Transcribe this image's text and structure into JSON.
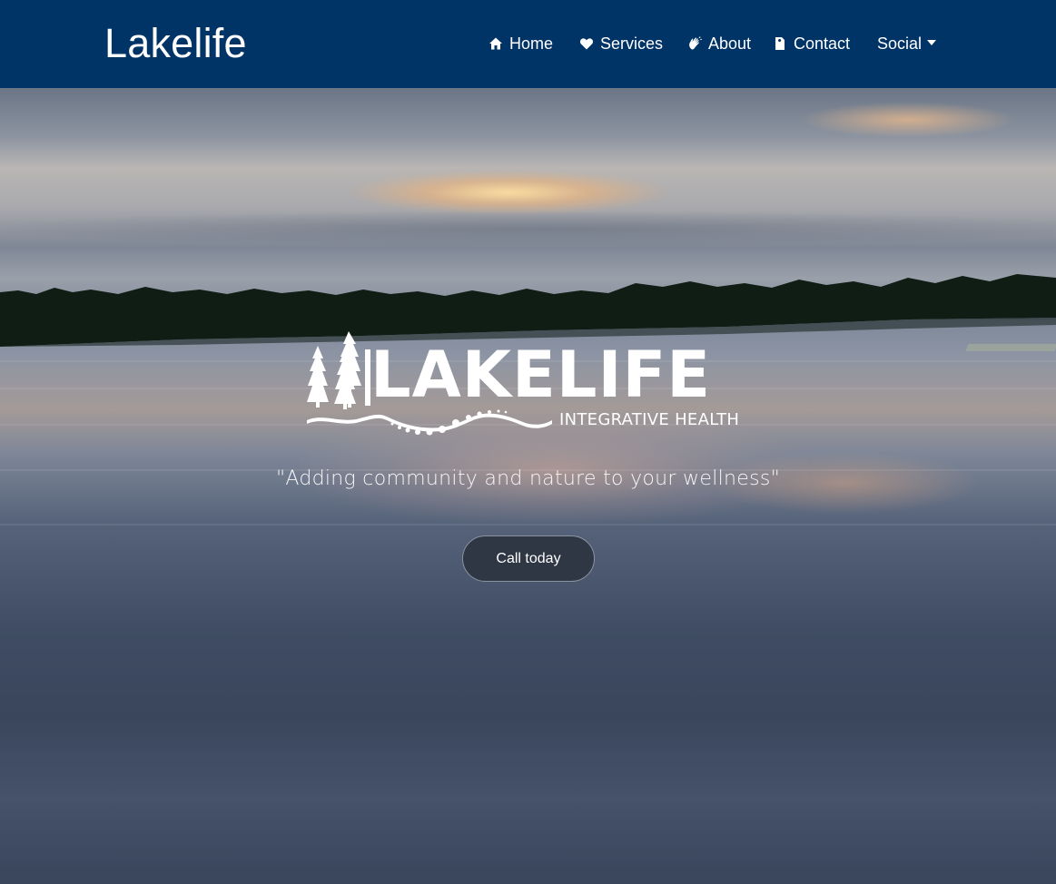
{
  "navbar": {
    "brand": "Lakelife",
    "background": "#003366",
    "items": [
      {
        "label": "Home",
        "icon": "home-icon"
      },
      {
        "label": "Services",
        "icon": "heart-icon"
      },
      {
        "label": "About",
        "icon": "hand-wave-icon"
      },
      {
        "label": "Contact",
        "icon": "document-icon"
      }
    ],
    "dropdown": {
      "label": "Social",
      "icon": "caret-down-icon"
    }
  },
  "hero": {
    "background": "lake-sunset-photo",
    "logo": {
      "word": "LAKELIFE",
      "subtitle": "INTEGRATIVE HEALTH"
    },
    "tagline": "\"Adding community and nature to your wellness\"",
    "cta_label": "Call today"
  }
}
